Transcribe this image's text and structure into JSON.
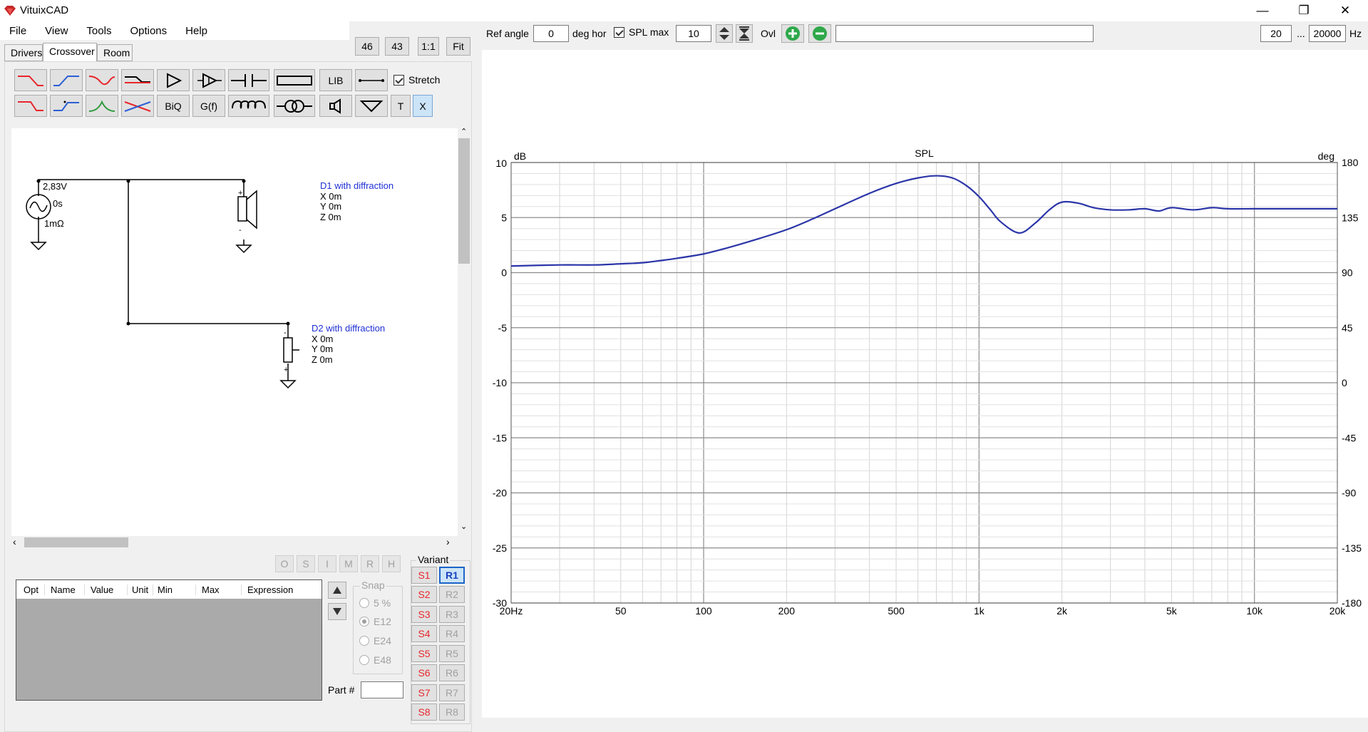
{
  "app": {
    "title": "VituixCAD"
  },
  "window_controls": {
    "min": "—",
    "max": "❐",
    "close": "✕"
  },
  "menu": [
    "File",
    "View",
    "Tools",
    "Options",
    "Help"
  ],
  "zoom_buttons": [
    "46",
    "43",
    "1:1",
    "Fit"
  ],
  "tabs": [
    "Drivers",
    "Crossover",
    "Room"
  ],
  "toolbar": {
    "lib": "LIB",
    "biq": "BiQ",
    "gf": "G(f)",
    "t": "T",
    "x": "X",
    "stretch": "Stretch"
  },
  "schematic": {
    "source": {
      "voltage": "2,83V",
      "delay": "0s",
      "impedance": "1mΩ"
    },
    "d1": {
      "name": "D1 with diffraction",
      "x": "X 0m",
      "y": "Y 0m",
      "z": "Z 0m"
    },
    "d2": {
      "name": "D2 with diffraction",
      "x": "X 0m",
      "y": "Y 0m",
      "z": "Z 0m"
    }
  },
  "opt_buttons": [
    "O",
    "S",
    "I",
    "M",
    "R",
    "H"
  ],
  "table": {
    "columns": [
      "Opt",
      "Name",
      "Value",
      "Unit",
      "Min",
      "Max",
      "Expression"
    ]
  },
  "snap": {
    "label": "Snap",
    "options": [
      "5 %",
      "E12",
      "E24",
      "E48"
    ],
    "selected": "E12"
  },
  "part": {
    "label": "Part #",
    "value": ""
  },
  "variant": {
    "label": "Variant",
    "s": [
      "S1",
      "S2",
      "S3",
      "S4",
      "S5",
      "S6",
      "S7",
      "S8"
    ],
    "r": [
      "R1",
      "R2",
      "R3",
      "R4",
      "R5",
      "R6",
      "R7",
      "R8"
    ],
    "selected": "R1"
  },
  "top_controls": {
    "ref_angle_label": "Ref angle",
    "ref_angle_value": "0",
    "deg_hor": "deg hor",
    "spl_max_label": "SPL max",
    "spl_max_value": "10",
    "ovl": "Ovl",
    "overlay_text": "",
    "f_min": "20",
    "ellipsis": "...",
    "f_max": "20000",
    "hz": "Hz"
  },
  "chart_data": {
    "type": "line",
    "title": "SPL",
    "ylabel_left": "dB",
    "ylabel_right": "deg",
    "x_scale": "log",
    "xlim": [
      20,
      20000
    ],
    "ylim": [
      -30,
      10
    ],
    "ylim_right": [
      -180,
      180
    ],
    "x_ticks": [
      "20Hz",
      "50",
      "100",
      "200",
      "500",
      "1k",
      "2k",
      "5k",
      "10k",
      "20k"
    ],
    "y_ticks": [
      "10",
      "5",
      "0",
      "-5",
      "-10",
      "-15",
      "-20",
      "-25",
      "-30"
    ],
    "y_ticks_right": [
      "180",
      "135",
      "90",
      "45",
      "0",
      "-45",
      "-90",
      "-135",
      "-180"
    ],
    "grid": true,
    "series": [
      {
        "color": "#2b35a8",
        "x": [
          20,
          30,
          40,
          50,
          60,
          70,
          80,
          100,
          120,
          150,
          200,
          250,
          300,
          400,
          500,
          600,
          700,
          800,
          900,
          1000,
          1100,
          1200,
          1400,
          1600,
          1800,
          2000,
          2300,
          2600,
          3000,
          3500,
          4000,
          4500,
          5000,
          6000,
          7000,
          8000,
          10000,
          12000,
          15000,
          20000
        ],
        "y": [
          0.6,
          0.7,
          0.7,
          0.8,
          0.9,
          1.1,
          1.3,
          1.7,
          2.2,
          2.9,
          3.9,
          4.9,
          5.8,
          7.2,
          8.1,
          8.6,
          8.8,
          8.6,
          7.9,
          6.9,
          5.7,
          4.6,
          3.6,
          4.5,
          5.7,
          6.4,
          6.3,
          5.9,
          5.7,
          5.7,
          5.8,
          5.6,
          5.9,
          5.7,
          5.9,
          5.8,
          5.8,
          5.8,
          5.8,
          5.8
        ]
      }
    ]
  },
  "colors": {
    "accent_red": "#e8262c",
    "accent_blue": "#2b5fd6",
    "curve": "#2b35a8",
    "driver_text": "#1f2fd6"
  }
}
